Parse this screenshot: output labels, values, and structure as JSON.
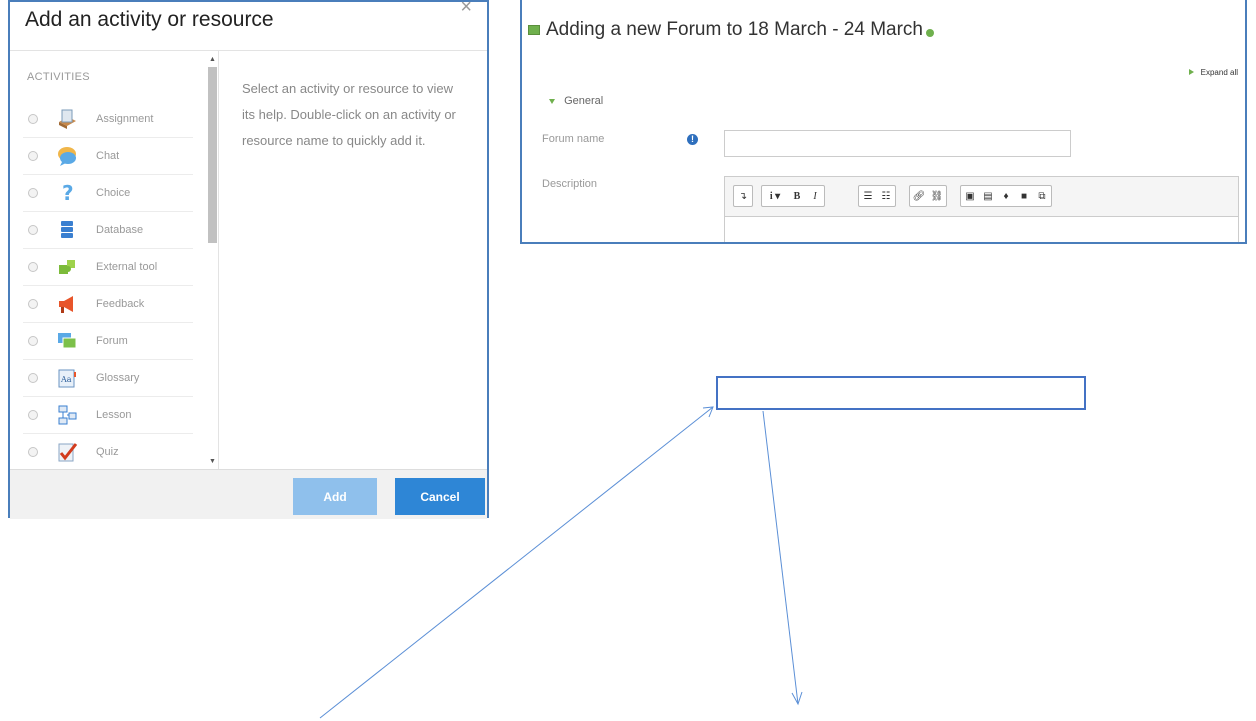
{
  "dialog": {
    "title": "Add an activity or resource",
    "close_symbol": "×",
    "section_label": "ACTIVITIES",
    "items": [
      {
        "label": "Assignment",
        "icon": "assignment-icon"
      },
      {
        "label": "Chat",
        "icon": "chat-icon"
      },
      {
        "label": "Choice",
        "icon": "choice-icon"
      },
      {
        "label": "Database",
        "icon": "database-icon"
      },
      {
        "label": "External tool",
        "icon": "external-tool-icon"
      },
      {
        "label": "Feedback",
        "icon": "feedback-icon"
      },
      {
        "label": "Forum",
        "icon": "forum-icon"
      },
      {
        "label": "Glossary",
        "icon": "glossary-icon"
      },
      {
        "label": "Lesson",
        "icon": "lesson-icon"
      },
      {
        "label": "Quiz",
        "icon": "quiz-icon"
      }
    ],
    "help_text": "Select an activity or resource to view its help. Double-click on an activity or resource name to quickly add it.",
    "add_label": "Add",
    "cancel_label": "Cancel"
  },
  "form": {
    "title": "Adding a new Forum to 18 March - 24 March",
    "expand_all": "Expand all",
    "section": "General",
    "forum_name_label": "Forum name",
    "forum_name_value": "",
    "description_label": "Description",
    "required_icon": "!"
  },
  "colors": {
    "frame_border": "#4a7ebb",
    "add_button": "#8fc0ec",
    "cancel_button": "#2e86d6",
    "accent_green": "#6fb04d"
  }
}
